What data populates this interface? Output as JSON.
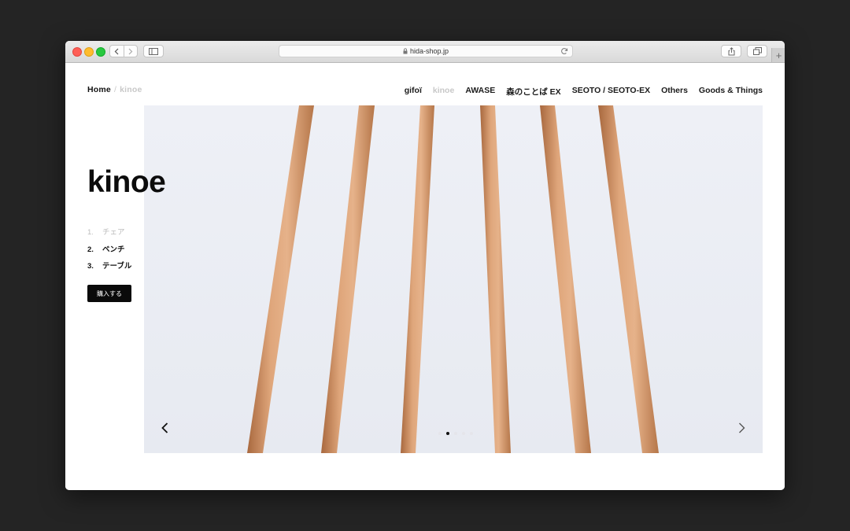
{
  "browser": {
    "url": "hida-shop.jp",
    "icons": {
      "back": "chevron-left-icon",
      "forward": "chevron-right-icon",
      "sidebar": "sidebar-icon",
      "lock": "lock-icon",
      "reload": "reload-icon",
      "share": "share-icon",
      "tabs": "tabs-icon",
      "new_tab": "plus-icon"
    },
    "new_tab_label": "+"
  },
  "breadcrumb": {
    "home": "Home",
    "separator": "/",
    "current": "kinoe"
  },
  "nav": {
    "items": [
      {
        "label": "gifoï",
        "active": false
      },
      {
        "label": "kinoe",
        "active": true
      },
      {
        "label": "AWASE",
        "active": false
      },
      {
        "label": "森のことば EX",
        "active": false
      },
      {
        "label": "SEOTO / SEOTO-EX",
        "active": false
      },
      {
        "label": "Others",
        "active": false
      },
      {
        "label": "Goods & Things",
        "active": false
      }
    ]
  },
  "main": {
    "title": "kinoe",
    "list": [
      {
        "num": "1.",
        "label": "チェア",
        "active": false
      },
      {
        "num": "2.",
        "label": "ベンチ",
        "active": true
      },
      {
        "num": "3.",
        "label": "テーブル",
        "active": true
      }
    ],
    "buy_label": "購入する"
  },
  "slider": {
    "slide_count": 5,
    "current_slide": 2,
    "icons": {
      "prev": "chevron-left-icon",
      "next": "chevron-right-icon"
    }
  },
  "colors": {
    "accent": "#000000",
    "muted": "#c8c8c8",
    "wood": "#d69a6e",
    "hero_background": "#eceff5"
  }
}
